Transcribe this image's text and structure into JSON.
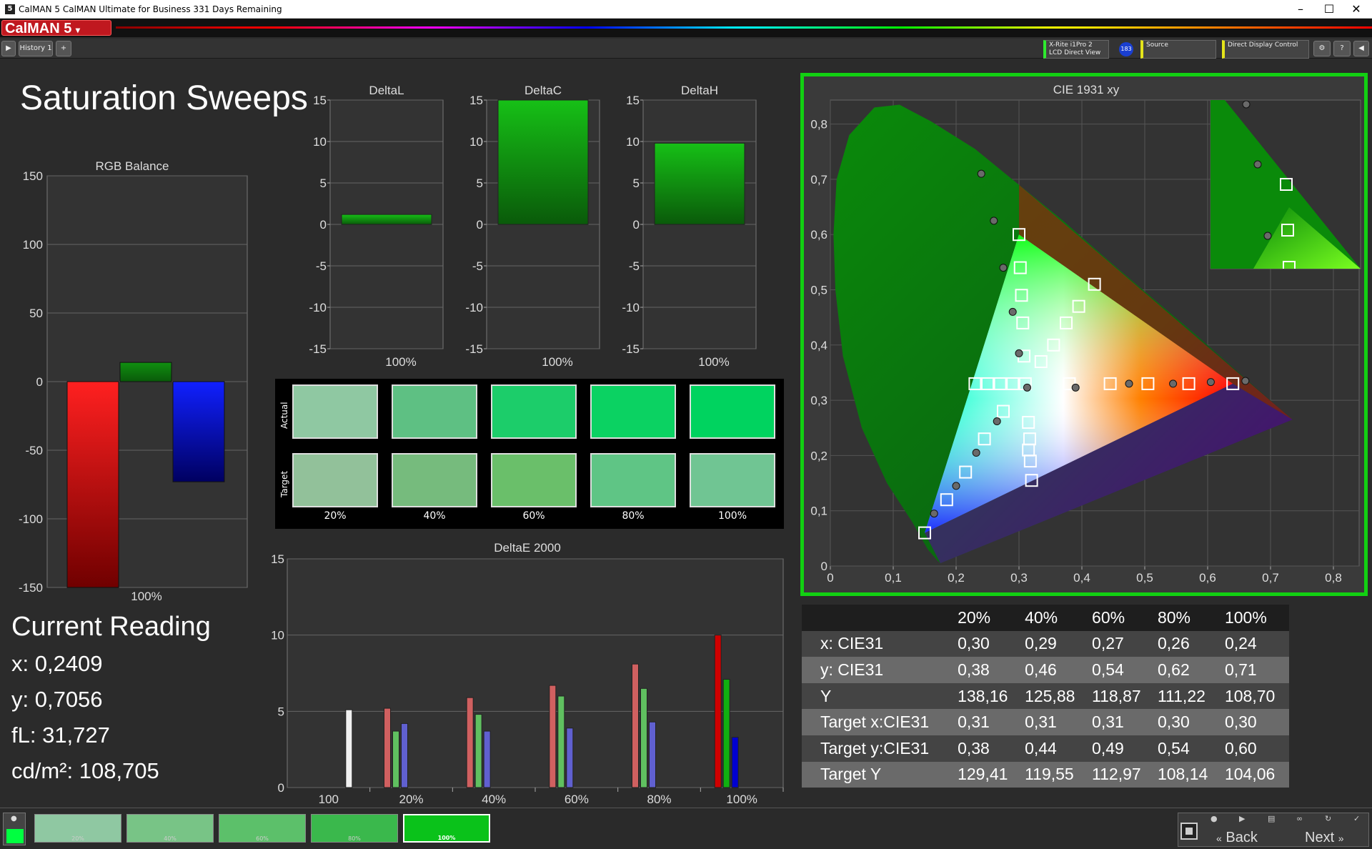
{
  "window": {
    "title": "CalMAN 5 CalMAN Ultimate for Business 331 Days Remaining",
    "icon": "5"
  },
  "logo": {
    "text": "CalMAN 5"
  },
  "tabs": [
    {
      "label": "History 1"
    }
  ],
  "devices": {
    "meter_line1": "X-Rite i1Pro 2",
    "meter_line2": "LCD Direct View",
    "badge": "183",
    "source": "Source",
    "display": "Direct Display Control"
  },
  "page_title": "Saturation Sweeps",
  "rgb_balance": {
    "title": "RGB Balance",
    "xlabel": "100%",
    "ylim": [
      -150,
      150
    ],
    "ticks": [
      150,
      100,
      50,
      0,
      -50,
      -100,
      -150
    ],
    "values": {
      "red": -150,
      "green": 14,
      "blue": -73
    }
  },
  "delta_charts": [
    {
      "title": "DeltaL",
      "xlabel": "100%",
      "value": 1.2,
      "ylim": [
        -15,
        15
      ]
    },
    {
      "title": "DeltaC",
      "xlabel": "100%",
      "value": 15,
      "ylim": [
        -15,
        15
      ]
    },
    {
      "title": "DeltaH",
      "xlabel": "100%",
      "value": 9.8,
      "ylim": [
        -15,
        15
      ]
    }
  ],
  "delta_ticks": [
    15,
    10,
    5,
    0,
    -5,
    -10,
    -15
  ],
  "swatches": {
    "actual_label": "Actual",
    "target_label": "Target",
    "labels": [
      "20%",
      "40%",
      "60%",
      "80%",
      "100%"
    ],
    "actual": [
      "#8fc8a2",
      "#5ec083",
      "#1ccd6a",
      "#0bd262",
      "#00d35f"
    ],
    "target": [
      "#92c19a",
      "#76bb7d",
      "#6abf6a",
      "#5fc585",
      "#70c593"
    ]
  },
  "deltae": {
    "title": "DeltaE 2000",
    "categories": [
      "100",
      "20%",
      "40%",
      "60%",
      "80%",
      "100%"
    ],
    "ylim": [
      0,
      15
    ],
    "ticks": [
      15,
      10,
      5,
      0
    ],
    "series": [
      {
        "values": [
          5.1,
          5.2,
          5.9,
          6.7,
          8.1,
          10.0
        ],
        "color": "#d06060"
      },
      {
        "values": [
          0,
          3.7,
          4.8,
          6.0,
          6.5,
          7.1
        ],
        "color": "#60c060"
      },
      {
        "values": [
          0,
          4.2,
          3.7,
          3.9,
          4.3,
          3.3
        ],
        "color": "#6060d0"
      }
    ]
  },
  "cie": {
    "title": "CIE 1931 xy",
    "xticks": [
      "0",
      "0,1",
      "0,2",
      "0,3",
      "0,4",
      "0,5",
      "0,6",
      "0,7",
      "0,8"
    ],
    "yticks": [
      "0,8",
      "0,7",
      "0,6",
      "0,5",
      "0,4",
      "0,3",
      "0,2",
      "0,1",
      "0"
    ]
  },
  "current_reading": {
    "title": "Current Reading",
    "x": "x: 0,2409",
    "y": "y: 0,7056",
    "fl": "fL: 31,727",
    "cdm2": "cd/m²: 108,705"
  },
  "table": {
    "headers": [
      "",
      "20%",
      "40%",
      "60%",
      "80%",
      "100%"
    ],
    "rows": [
      {
        "label": "x: CIE31",
        "values": [
          "0,30",
          "0,29",
          "0,27",
          "0,26",
          "0,24"
        ]
      },
      {
        "label": "y: CIE31",
        "values": [
          "0,38",
          "0,46",
          "0,54",
          "0,62",
          "0,71"
        ]
      },
      {
        "label": "Y",
        "values": [
          "138,16",
          "125,88",
          "118,87",
          "111,22",
          "108,70"
        ]
      },
      {
        "label": "Target x:CIE31",
        "values": [
          "0,31",
          "0,31",
          "0,31",
          "0,30",
          "0,30"
        ]
      },
      {
        "label": "Target y:CIE31",
        "values": [
          "0,38",
          "0,44",
          "0,49",
          "0,54",
          "0,60"
        ]
      },
      {
        "label": "Target Y",
        "values": [
          "129,41",
          "119,55",
          "112,97",
          "108,14",
          "104,06"
        ]
      }
    ]
  },
  "bottom_swatches": [
    {
      "label": "20%",
      "color": "#8fc8a2"
    },
    {
      "label": "40%",
      "color": "#78c486"
    },
    {
      "label": "60%",
      "color": "#5cc06a"
    },
    {
      "label": "80%",
      "color": "#3ab84c"
    },
    {
      "label": "100%",
      "color": "#0ac21a"
    }
  ],
  "nav": {
    "back": "Back",
    "next": "Next"
  }
}
